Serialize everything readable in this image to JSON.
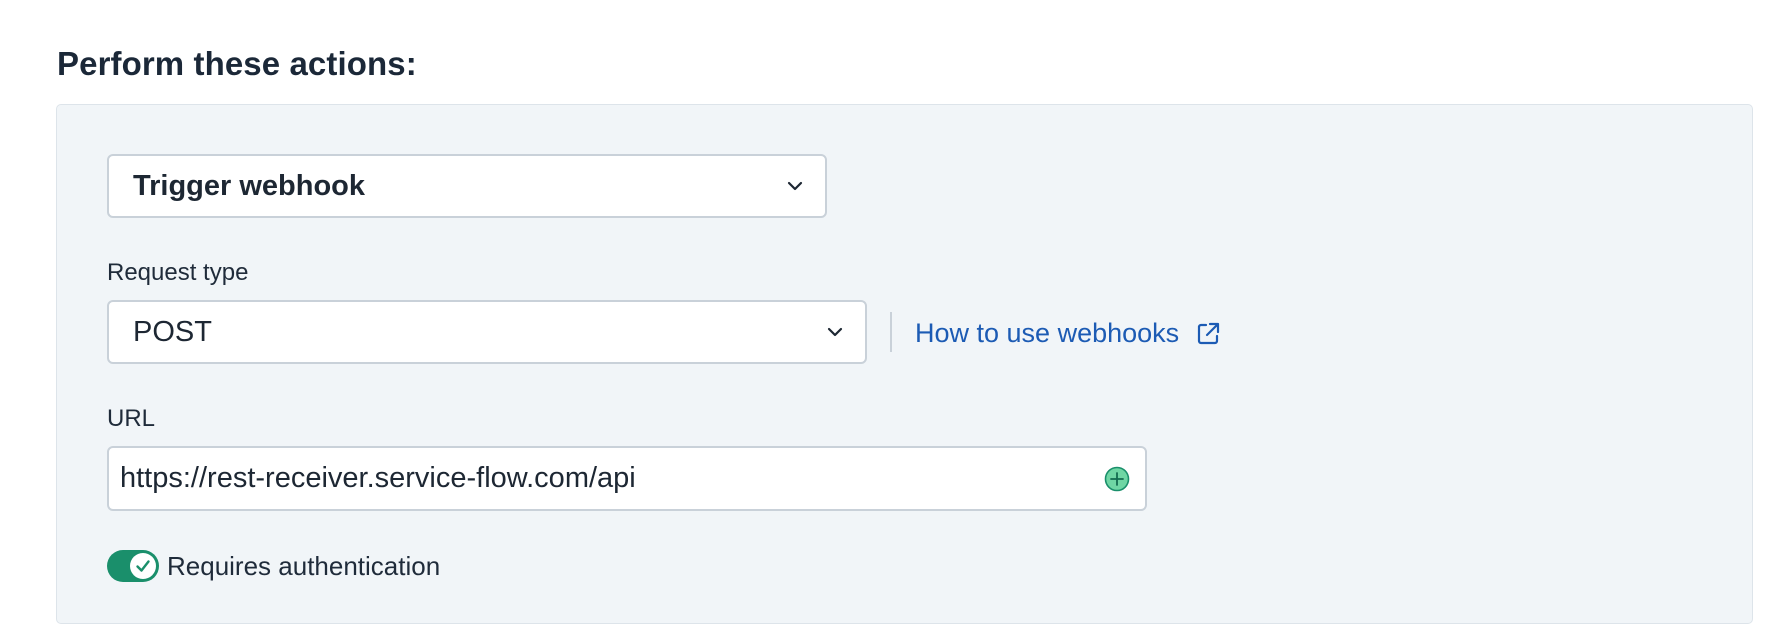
{
  "section": {
    "title": "Perform these actions:"
  },
  "action": {
    "selected": "Trigger webhook",
    "chevron_icon": "chevron-down-icon"
  },
  "request_type": {
    "label": "Request type",
    "selected": "POST"
  },
  "help": {
    "link_text": "How to use webhooks",
    "icon": "external-link-icon"
  },
  "url": {
    "label": "URL",
    "value": "https://rest-receiver.service-flow.com/api",
    "add_icon": "add-placeholder-icon"
  },
  "auth": {
    "label": "Requires authentication",
    "enabled": true
  },
  "colors": {
    "link": "#1c5bb4",
    "toggle_on": "#1a8f6b",
    "panel_bg": "#f1f5f8"
  }
}
